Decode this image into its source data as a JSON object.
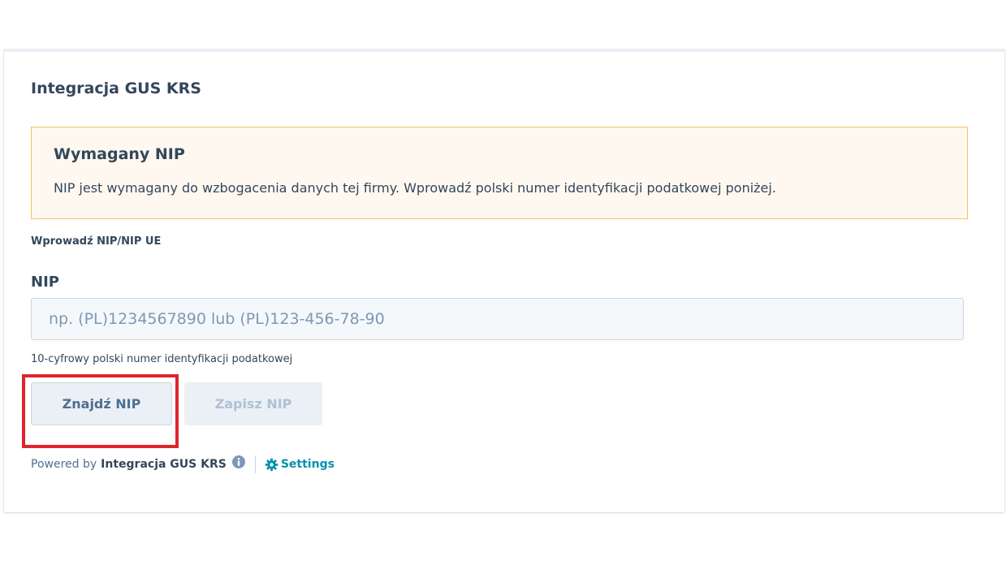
{
  "card": {
    "title": "Integracja GUS KRS"
  },
  "alert": {
    "title": "Wymagany NIP",
    "body": "NIP jest wymagany do wzbogacenia danych tej firmy. Wprowadź polski numer identyfikacji podatkowej poniżej."
  },
  "form": {
    "section_label": "Wprowadź NIP/NIP UE",
    "nip_label": "NIP",
    "nip_value": "",
    "nip_placeholder": "np. (PL)1234567890 lub (PL)123-456-78-90",
    "help_text": "10-cyfrowy polski numer identyfikacji podatkowej"
  },
  "buttons": {
    "find_label": "Znajdź NIP",
    "save_label": "Zapisz NIP"
  },
  "footer": {
    "powered_by": "Powered by",
    "app_name": "Integracja GUS KRS",
    "settings_label": "Settings",
    "info_icon": "info-circle-icon",
    "settings_icon": "gear-icon"
  },
  "colors": {
    "text": "#33475b",
    "alert_background": "#fef8f0",
    "alert_border": "#f5c26b",
    "input_background": "#f5f8fa",
    "link": "#0091ae",
    "highlight": "#e0242d"
  }
}
